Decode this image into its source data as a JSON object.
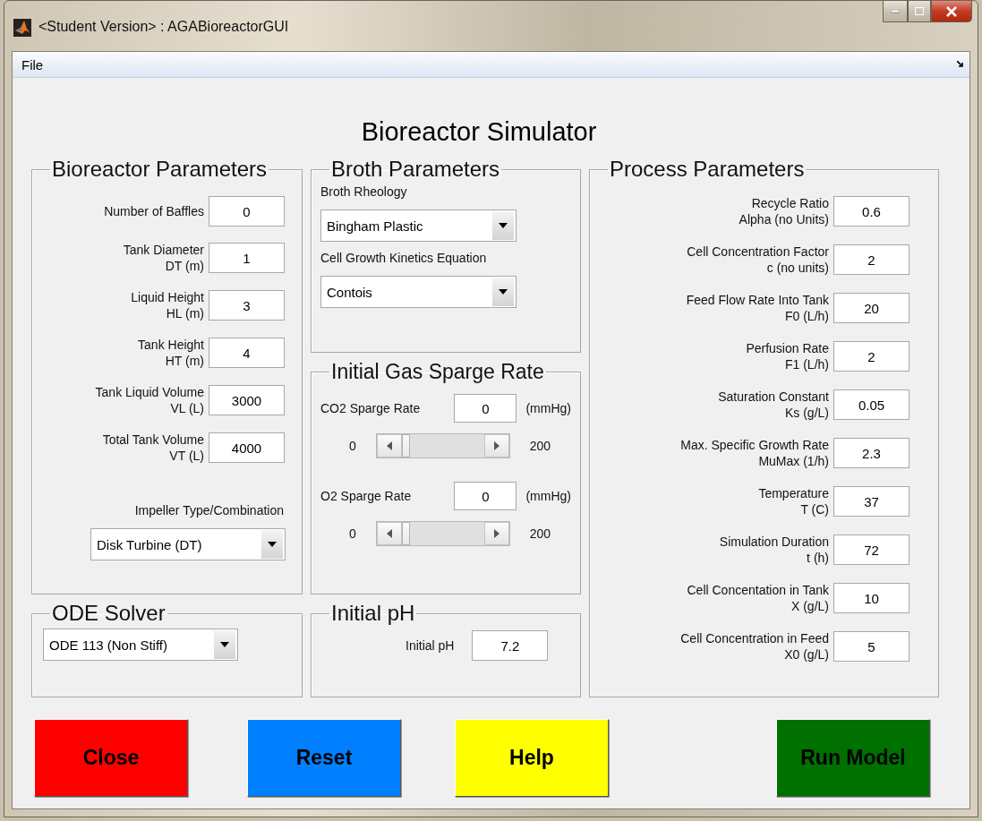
{
  "window": {
    "title": "<Student Version> : AGABioreactorGUI"
  },
  "menu": [
    {
      "label": "File"
    }
  ],
  "heading": "Bioreactor Simulator",
  "bioreactor_parameters": {
    "title": "Bioreactor Parameters",
    "fields": [
      {
        "lines": [
          "Number of Baffles"
        ],
        "value": "0"
      },
      {
        "lines": [
          "Tank Diameter",
          "DT (m)"
        ],
        "value": "1"
      },
      {
        "lines": [
          "Liquid Height",
          "HL (m)"
        ],
        "value": "3"
      },
      {
        "lines": [
          "Tank Height",
          "HT (m)"
        ],
        "value": "4"
      },
      {
        "lines": [
          "Tank Liquid Volume",
          "VL (L)"
        ],
        "value": "3000"
      },
      {
        "lines": [
          "Total Tank Volume",
          "VT (L)"
        ],
        "value": "4000"
      }
    ],
    "impeller": {
      "label": "Impeller Type/Combination",
      "value": "Disk Turbine (DT)"
    }
  },
  "broth_parameters": {
    "title": "Broth Parameters",
    "dropdowns": [
      {
        "label": "Broth Rheology",
        "value": "Bingham Plastic"
      },
      {
        "label": "Cell Growth Kinetics Equation",
        "value": "Contois"
      }
    ]
  },
  "gas_sparge": {
    "title": "Initial Gas Sparge Rate",
    "rates": [
      {
        "label": "CO2 Sparge Rate",
        "value": "0",
        "unit": "(mmHg)",
        "min": "0",
        "max": "200",
        "level": 0
      },
      {
        "label": "O2 Sparge Rate",
        "value": "0",
        "unit": "(mmHg)",
        "min": "0",
        "max": "200",
        "level": 0
      }
    ]
  },
  "process_parameters": {
    "title": "Process Parameters",
    "fields": [
      {
        "lines": [
          "Recycle Ratio",
          "Alpha (no Units)"
        ],
        "value": "0.6"
      },
      {
        "lines": [
          "Cell Concentration Factor",
          "c (no units)"
        ],
        "value": "2"
      },
      {
        "lines": [
          "Feed Flow Rate Into Tank",
          "F0 (L/h)"
        ],
        "value": "20"
      },
      {
        "lines": [
          "Perfusion Rate",
          "F1 (L/h)"
        ],
        "value": "2"
      },
      {
        "lines": [
          "Saturation Constant",
          "Ks (g/L)"
        ],
        "value": "0.05"
      },
      {
        "lines": [
          "Max. Specific Growth Rate",
          "MuMax (1/h)"
        ],
        "value": "2.3"
      },
      {
        "lines": [
          "Temperature",
          "T (C)"
        ],
        "value": "37"
      },
      {
        "lines": [
          "Simulation Duration",
          "t (h)"
        ],
        "value": "72"
      },
      {
        "lines": [
          "Cell Concentation in Tank",
          "X (g/L)"
        ],
        "value": "10"
      },
      {
        "lines": [
          "Cell Concentration in Feed",
          "X0 (g/L)"
        ],
        "value": "5"
      }
    ]
  },
  "ode_solver": {
    "title": "ODE Solver",
    "value": "ODE 113 (Non Stiff)"
  },
  "initial_ph": {
    "title": "Initial pH",
    "label": "Initial pH",
    "value": "7.2"
  },
  "buttons": [
    {
      "label": "Close",
      "color": "#ff0000"
    },
    {
      "label": "Reset",
      "color": "#0080ff"
    },
    {
      "label": "Help",
      "color": "#ffff00"
    },
    {
      "label": "Run Model",
      "color": "#007000"
    }
  ]
}
